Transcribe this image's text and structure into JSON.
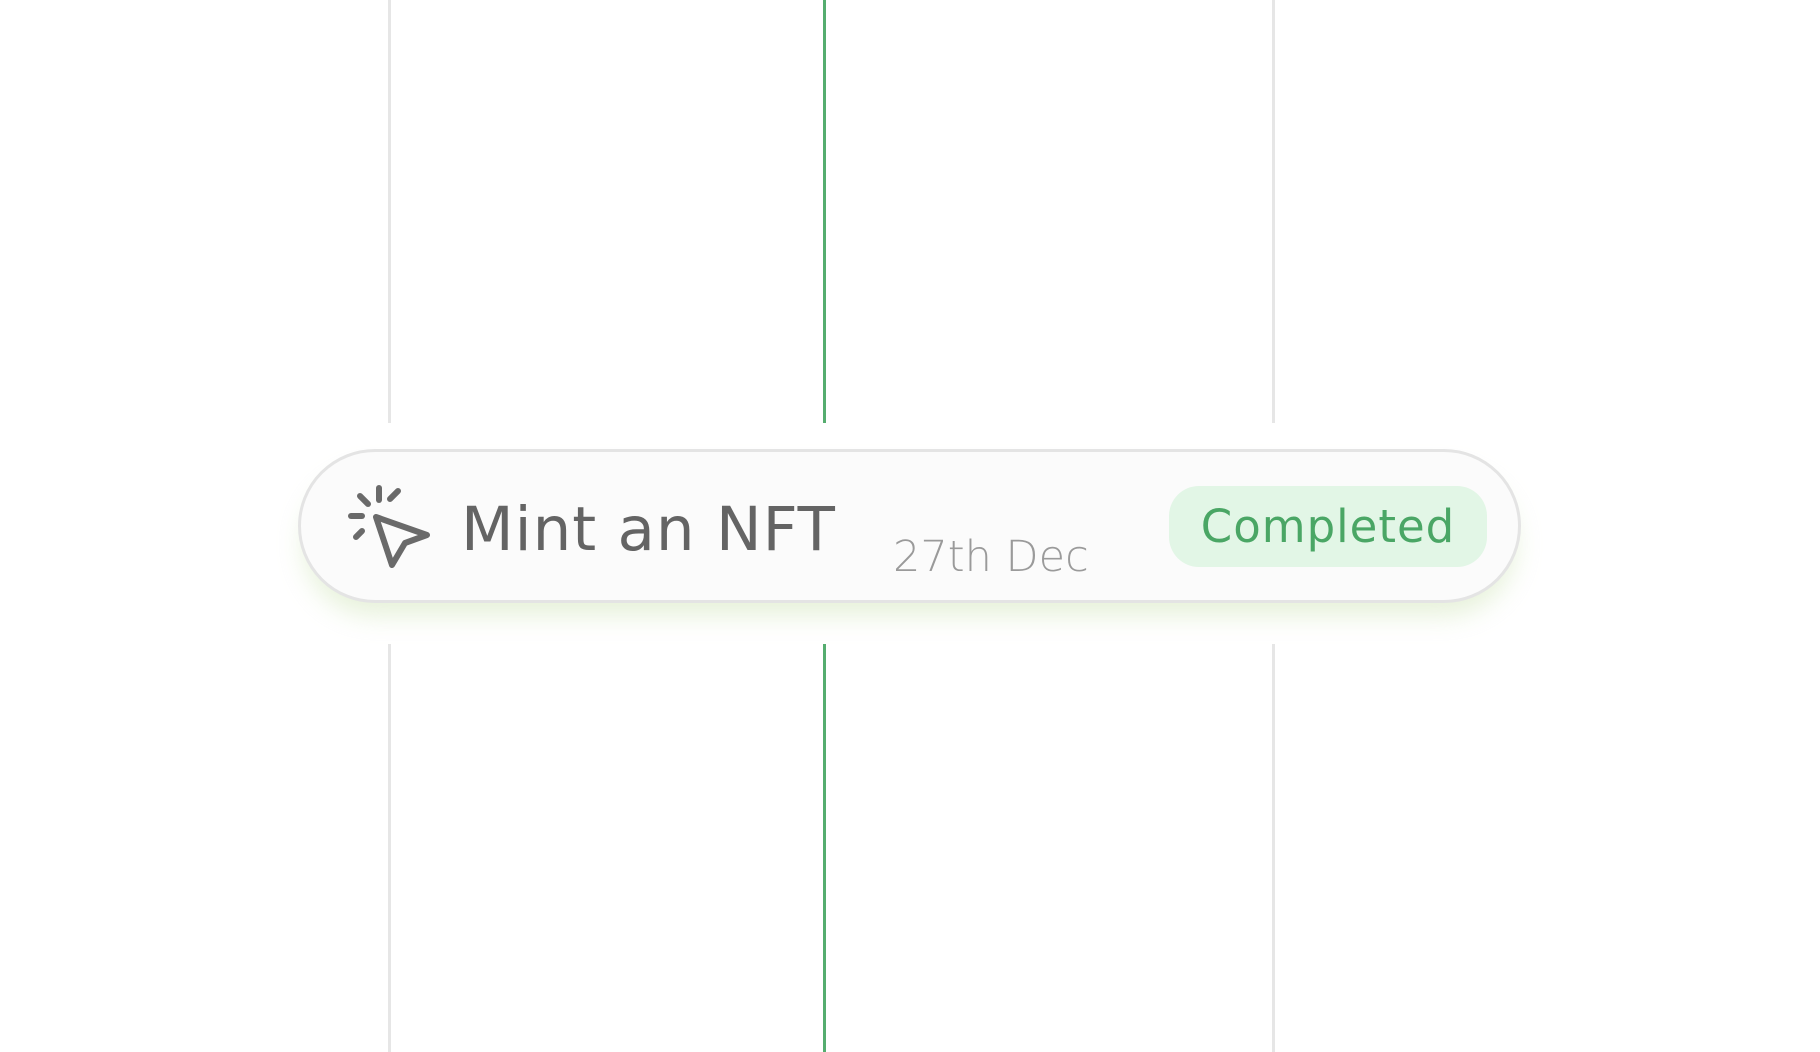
{
  "task": {
    "title": "Mint an NFT",
    "date": "27th Dec",
    "status": "Completed",
    "icon": "cursor-click-icon"
  },
  "colors": {
    "accent": "#55ad6f",
    "badge_background": "#e2f6e6",
    "badge_text": "#4aa665",
    "title_text": "#646464",
    "date_text": "#9a9a9a",
    "divider": "#e6e6e6"
  }
}
